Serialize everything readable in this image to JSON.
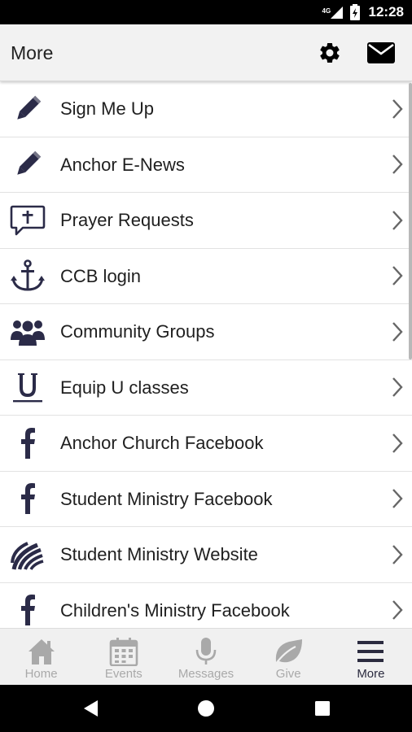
{
  "status_bar": {
    "time": "12:28",
    "network": "4G"
  },
  "header": {
    "title": "More"
  },
  "menu": {
    "items": [
      {
        "label": "Sign Me Up",
        "icon": "pencil-icon"
      },
      {
        "label": "Anchor E-News",
        "icon": "pencil-icon"
      },
      {
        "label": "Prayer Requests",
        "icon": "prayer-speech-cross-icon"
      },
      {
        "label": "CCB login",
        "icon": "anchor-icon"
      },
      {
        "label": "Community Groups",
        "icon": "group-icon"
      },
      {
        "label": "Equip U classes",
        "icon": "u-logo-icon"
      },
      {
        "label": "Anchor Church Facebook",
        "icon": "facebook-icon"
      },
      {
        "label": "Student Ministry Facebook",
        "icon": "facebook-icon"
      },
      {
        "label": "Student Ministry Website",
        "icon": "student-ministry-logo-icon"
      },
      {
        "label": "Children's Ministry Facebook",
        "icon": "facebook-icon"
      }
    ]
  },
  "tabs": [
    {
      "label": "Home",
      "icon": "home-icon",
      "active": false
    },
    {
      "label": "Events",
      "icon": "calendar-icon",
      "active": false
    },
    {
      "label": "Messages",
      "icon": "microphone-icon",
      "active": false
    },
    {
      "label": "Give",
      "icon": "leaf-icon",
      "active": false
    },
    {
      "label": "More",
      "icon": "hamburger-menu-icon",
      "active": true
    }
  ],
  "colors": {
    "icon_dark": "#2b2b48",
    "tab_inactive": "#a9a9a9",
    "tab_active": "#2b2b3f",
    "header_bg": "#f2f2f2",
    "status_bar_bg": "#000000"
  }
}
